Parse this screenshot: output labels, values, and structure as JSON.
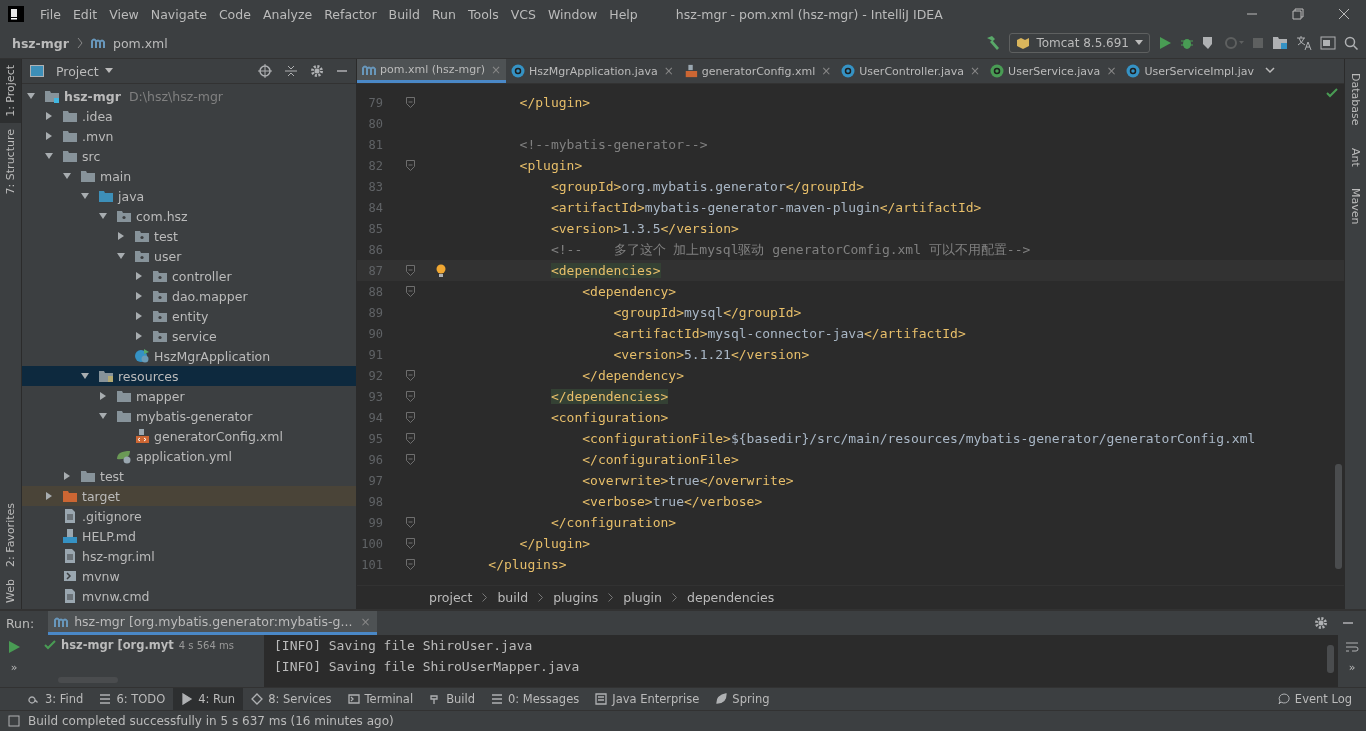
{
  "window": {
    "title": "hsz-mgr - pom.xml (hsz-mgr) - IntelliJ IDEA"
  },
  "menu": [
    "File",
    "Edit",
    "View",
    "Navigate",
    "Code",
    "Analyze",
    "Refactor",
    "Build",
    "Run",
    "Tools",
    "VCS",
    "Window",
    "Help"
  ],
  "navbar": {
    "project": "hsz-mgr",
    "file": "pom.xml",
    "run_config": "Tomcat 8.5.691"
  },
  "left_stripe": [
    {
      "label": "1: Project",
      "selected": true
    },
    {
      "label": "7: Structure",
      "selected": false
    }
  ],
  "left_stripe_bottom": [
    {
      "label": "2: Favorites"
    },
    {
      "label": "Web"
    }
  ],
  "right_stripe": [
    {
      "label": "Database"
    },
    {
      "label": "Ant"
    },
    {
      "label": "Maven"
    }
  ],
  "project_panel": {
    "title": "Project",
    "tree": [
      {
        "label": "hsz-mgr",
        "hint": "D:\\hsz\\hsz-mgr",
        "kind": "module",
        "expanded": true,
        "selected": false,
        "children": [
          {
            "label": ".idea",
            "kind": "folder",
            "expanded": false,
            "selected": false
          },
          {
            "label": ".mvn",
            "kind": "folder",
            "expanded": false,
            "selected": false
          },
          {
            "label": "src",
            "kind": "folder",
            "expanded": true,
            "selected": false,
            "children": [
              {
                "label": "main",
                "kind": "folder",
                "expanded": true,
                "selected": false,
                "children": [
                  {
                    "label": "java",
                    "kind": "source",
                    "expanded": true,
                    "selected": false,
                    "children": [
                      {
                        "label": "com.hsz",
                        "kind": "package",
                        "expanded": true,
                        "selected": false,
                        "children": [
                          {
                            "label": "test",
                            "kind": "package",
                            "expanded": false,
                            "selected": false
                          },
                          {
                            "label": "user",
                            "kind": "package",
                            "expanded": true,
                            "selected": false,
                            "children": [
                              {
                                "label": "controller",
                                "kind": "package",
                                "expanded": false,
                                "selected": false
                              },
                              {
                                "label": "dao.mapper",
                                "kind": "package",
                                "expanded": false,
                                "selected": false
                              },
                              {
                                "label": "entity",
                                "kind": "package",
                                "expanded": false,
                                "selected": false
                              },
                              {
                                "label": "service",
                                "kind": "package",
                                "expanded": false,
                                "selected": false
                              }
                            ]
                          },
                          {
                            "label": "HszMgrApplication",
                            "kind": "app",
                            "selected": false
                          }
                        ]
                      }
                    ]
                  },
                  {
                    "label": "resources",
                    "kind": "resources",
                    "expanded": true,
                    "selected": true,
                    "children": [
                      {
                        "label": "mapper",
                        "kind": "folder",
                        "expanded": false,
                        "selected": false
                      },
                      {
                        "label": "mybatis-generator",
                        "kind": "folder",
                        "expanded": true,
                        "selected": false,
                        "children": [
                          {
                            "label": "generatorConfig.xml",
                            "kind": "xml",
                            "selected": false
                          }
                        ]
                      },
                      {
                        "label": "application.yml",
                        "kind": "yml",
                        "selected": false
                      }
                    ]
                  }
                ]
              },
              {
                "label": "test",
                "kind": "folder",
                "expanded": false,
                "selected": false
              }
            ]
          },
          {
            "label": "target",
            "kind": "excluded",
            "expanded": false,
            "selected": false
          },
          {
            "label": ".gitignore",
            "kind": "file",
            "selected": false
          },
          {
            "label": "HELP.md",
            "kind": "md",
            "selected": false
          },
          {
            "label": "hsz-mgr.iml",
            "kind": "file",
            "selected": false
          },
          {
            "label": "mvnw",
            "kind": "shell",
            "selected": false
          },
          {
            "label": "mvnw.cmd",
            "kind": "file",
            "selected": false
          }
        ]
      }
    ]
  },
  "tabs": [
    {
      "label": "pom.xml (hsz-mgr)",
      "kind": "maven",
      "close": "×",
      "selected": true
    },
    {
      "label": "HszMgrApplication.java",
      "kind": "app",
      "close": "×",
      "selected": false
    },
    {
      "label": "generatorConfig.xml",
      "kind": "xml",
      "close": "×",
      "selected": false
    },
    {
      "label": "UserController.java",
      "kind": "class",
      "close": "×",
      "selected": false
    },
    {
      "label": "UserService.java",
      "kind": "interface",
      "close": "×",
      "selected": false
    },
    {
      "label": "UserServiceImpl.jav",
      "kind": "class",
      "selected": false
    }
  ],
  "editor": {
    "lines": [
      {
        "number": "79",
        "fold": true,
        "current": false,
        "parts": [
          {
            "kind": "tag",
            "text": "        </plugin>"
          }
        ]
      },
      {
        "number": "80",
        "fold": false,
        "current": false
      },
      {
        "number": "81",
        "fold": false,
        "current": false,
        "parts": [
          {
            "kind": "comment",
            "text": "        <!--mybatis-generator-->"
          }
        ]
      },
      {
        "number": "82",
        "fold": true,
        "current": false,
        "parts": [
          {
            "kind": "tag",
            "text": "        <plugin>"
          }
        ]
      },
      {
        "number": "83",
        "fold": false,
        "current": false,
        "parts": [
          {
            "kind": "tag",
            "text": "            <groupId>"
          },
          {
            "kind": "text",
            "text": "org.mybatis.generator"
          },
          {
            "kind": "tag",
            "text": "</groupId>"
          }
        ]
      },
      {
        "number": "84",
        "fold": false,
        "current": false,
        "parts": [
          {
            "kind": "tag",
            "text": "            <artifactId>"
          },
          {
            "kind": "text",
            "text": "mybatis-generator-maven-plugin"
          },
          {
            "kind": "tag",
            "text": "</artifactId>"
          }
        ]
      },
      {
        "number": "85",
        "fold": false,
        "current": false,
        "parts": [
          {
            "kind": "tag",
            "text": "            <version>"
          },
          {
            "kind": "text",
            "text": "1.3.5"
          },
          {
            "kind": "tag",
            "text": "</version>"
          }
        ]
      },
      {
        "number": "86",
        "fold": false,
        "current": false,
        "parts": [
          {
            "kind": "comment",
            "text": "            <!--    多了这个 加上mysql驱动 generatorComfig.xml 可以不用配置-->"
          }
        ]
      },
      {
        "number": "87",
        "fold": true,
        "current": true,
        "bulb": true,
        "parts": [
          {
            "kind": "match",
            "text": "            <dependencies>"
          }
        ]
      },
      {
        "number": "88",
        "fold": true,
        "current": false,
        "parts": [
          {
            "kind": "tag",
            "text": "                <dependency>"
          }
        ]
      },
      {
        "number": "89",
        "fold": false,
        "current": false,
        "parts": [
          {
            "kind": "tag",
            "text": "                    <groupId>"
          },
          {
            "kind": "text",
            "text": "mysql"
          },
          {
            "kind": "tag",
            "text": "</groupId>"
          }
        ]
      },
      {
        "number": "90",
        "fold": false,
        "current": false,
        "parts": [
          {
            "kind": "tag",
            "text": "                    <artifactId>"
          },
          {
            "kind": "text",
            "text": "mysql-connector-java"
          },
          {
            "kind": "tag",
            "text": "</artifactId>"
          }
        ]
      },
      {
        "number": "91",
        "fold": false,
        "current": false,
        "parts": [
          {
            "kind": "tag",
            "text": "                    <version>"
          },
          {
            "kind": "text",
            "text": "5.1.21"
          },
          {
            "kind": "tag",
            "text": "</version>"
          }
        ]
      },
      {
        "number": "92",
        "fold": true,
        "current": false,
        "parts": [
          {
            "kind": "tag",
            "text": "                </dependency>"
          }
        ]
      },
      {
        "number": "93",
        "fold": true,
        "current": false,
        "parts": [
          {
            "kind": "match",
            "text": "            </dependencies>"
          }
        ]
      },
      {
        "number": "94",
        "fold": true,
        "current": false,
        "parts": [
          {
            "kind": "tag",
            "text": "            <configuration>"
          }
        ]
      },
      {
        "number": "95",
        "fold": true,
        "current": false,
        "parts": [
          {
            "kind": "tag",
            "text": "                <configurationFile>"
          },
          {
            "kind": "text",
            "text": "${basedir}/src/main/resources/mybatis-generator/generatorConfig.xml"
          }
        ]
      },
      {
        "number": "96",
        "fold": true,
        "current": false,
        "parts": [
          {
            "kind": "tag",
            "text": "                </configurationFile>"
          }
        ]
      },
      {
        "number": "97",
        "fold": false,
        "current": false,
        "parts": [
          {
            "kind": "tag",
            "text": "                <overwrite>"
          },
          {
            "kind": "text",
            "text": "true"
          },
          {
            "kind": "tag",
            "text": "</overwrite>"
          }
        ]
      },
      {
        "number": "98",
        "fold": false,
        "current": false,
        "parts": [
          {
            "kind": "tag",
            "text": "                <verbose>"
          },
          {
            "kind": "text",
            "text": "true"
          },
          {
            "kind": "tag",
            "text": "</verbose>"
          }
        ]
      },
      {
        "number": "99",
        "fold": true,
        "current": false,
        "parts": [
          {
            "kind": "tag",
            "text": "            </configuration>"
          }
        ]
      },
      {
        "number": "100",
        "fold": true,
        "current": false,
        "parts": [
          {
            "kind": "tag",
            "text": "        </plugin>"
          }
        ]
      },
      {
        "number": "101",
        "fold": true,
        "current": false,
        "parts": [
          {
            "kind": "tag",
            "text": "    </plugins>"
          }
        ]
      }
    ],
    "breadcrumbs": [
      "project",
      "build",
      "plugins",
      "plugin",
      "dependencies"
    ]
  },
  "run_panel": {
    "label": "Run:",
    "tab": "hsz-mgr [org.mybatis.generator:mybatis-g...",
    "tab_close": "×",
    "more": "»",
    "item": "hsz-mgr [org.myt",
    "time": "4 s 564 ms",
    "console": [
      "[INFO] Saving file ShiroUser.java",
      "[INFO] Saving file ShiroUserMapper.java"
    ]
  },
  "tool_windows": [
    {
      "label": "3: Find",
      "kind": "search",
      "selected": false
    },
    {
      "label": "6: TODO",
      "kind": "list",
      "selected": false
    },
    {
      "label": "4: Run",
      "kind": "run",
      "selected": true
    },
    {
      "label": "8: Services",
      "kind": "services",
      "selected": false
    },
    {
      "label": "Terminal",
      "kind": "terminal",
      "selected": false
    },
    {
      "label": "Build",
      "kind": "hammer",
      "selected": false
    },
    {
      "label": "0: Messages",
      "kind": "list",
      "selected": false
    },
    {
      "label": "Java Enterprise",
      "kind": "enterprise",
      "selected": false
    },
    {
      "label": "Spring",
      "kind": "leaf",
      "selected": false
    }
  ],
  "event_log": "Event Log",
  "status_bar": "Build completed successfully in 5 s 637 ms (16 minutes ago)"
}
